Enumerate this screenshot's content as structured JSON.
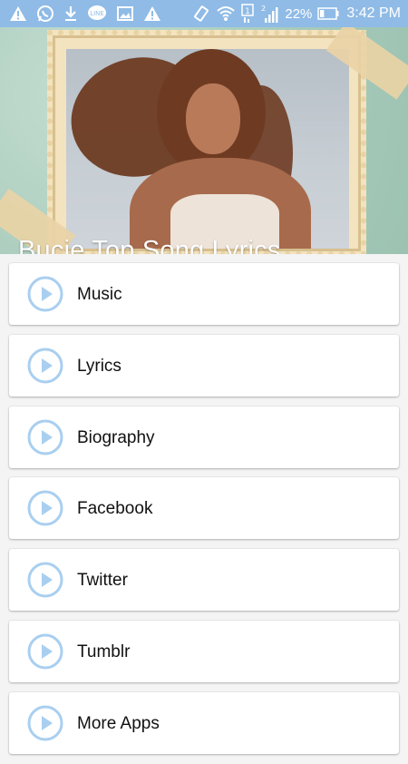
{
  "status_bar": {
    "left_icons": [
      "warning-icon",
      "whatsapp-icon",
      "download-icon",
      "line-icon",
      "gallery-icon",
      "warning-icon"
    ],
    "sim_label": "1",
    "signal_label": "2",
    "battery": "22%",
    "time": "3:42 PM"
  },
  "header": {
    "title": "Bucie Top Song Lyrics"
  },
  "menu": {
    "items": [
      {
        "label": "Music",
        "icon": "play-circle-icon"
      },
      {
        "label": "Lyrics",
        "icon": "play-circle-icon"
      },
      {
        "label": "Biography",
        "icon": "play-circle-icon"
      },
      {
        "label": "Facebook",
        "icon": "play-circle-icon"
      },
      {
        "label": "Twitter",
        "icon": "play-circle-icon"
      },
      {
        "label": "Tumblr",
        "icon": "play-circle-icon"
      },
      {
        "label": "More Apps",
        "icon": "play-circle-icon"
      }
    ]
  },
  "colors": {
    "status_bar": "#8fbbe6",
    "play_icon": "#a9cff0",
    "card_bg": "#ffffff"
  }
}
